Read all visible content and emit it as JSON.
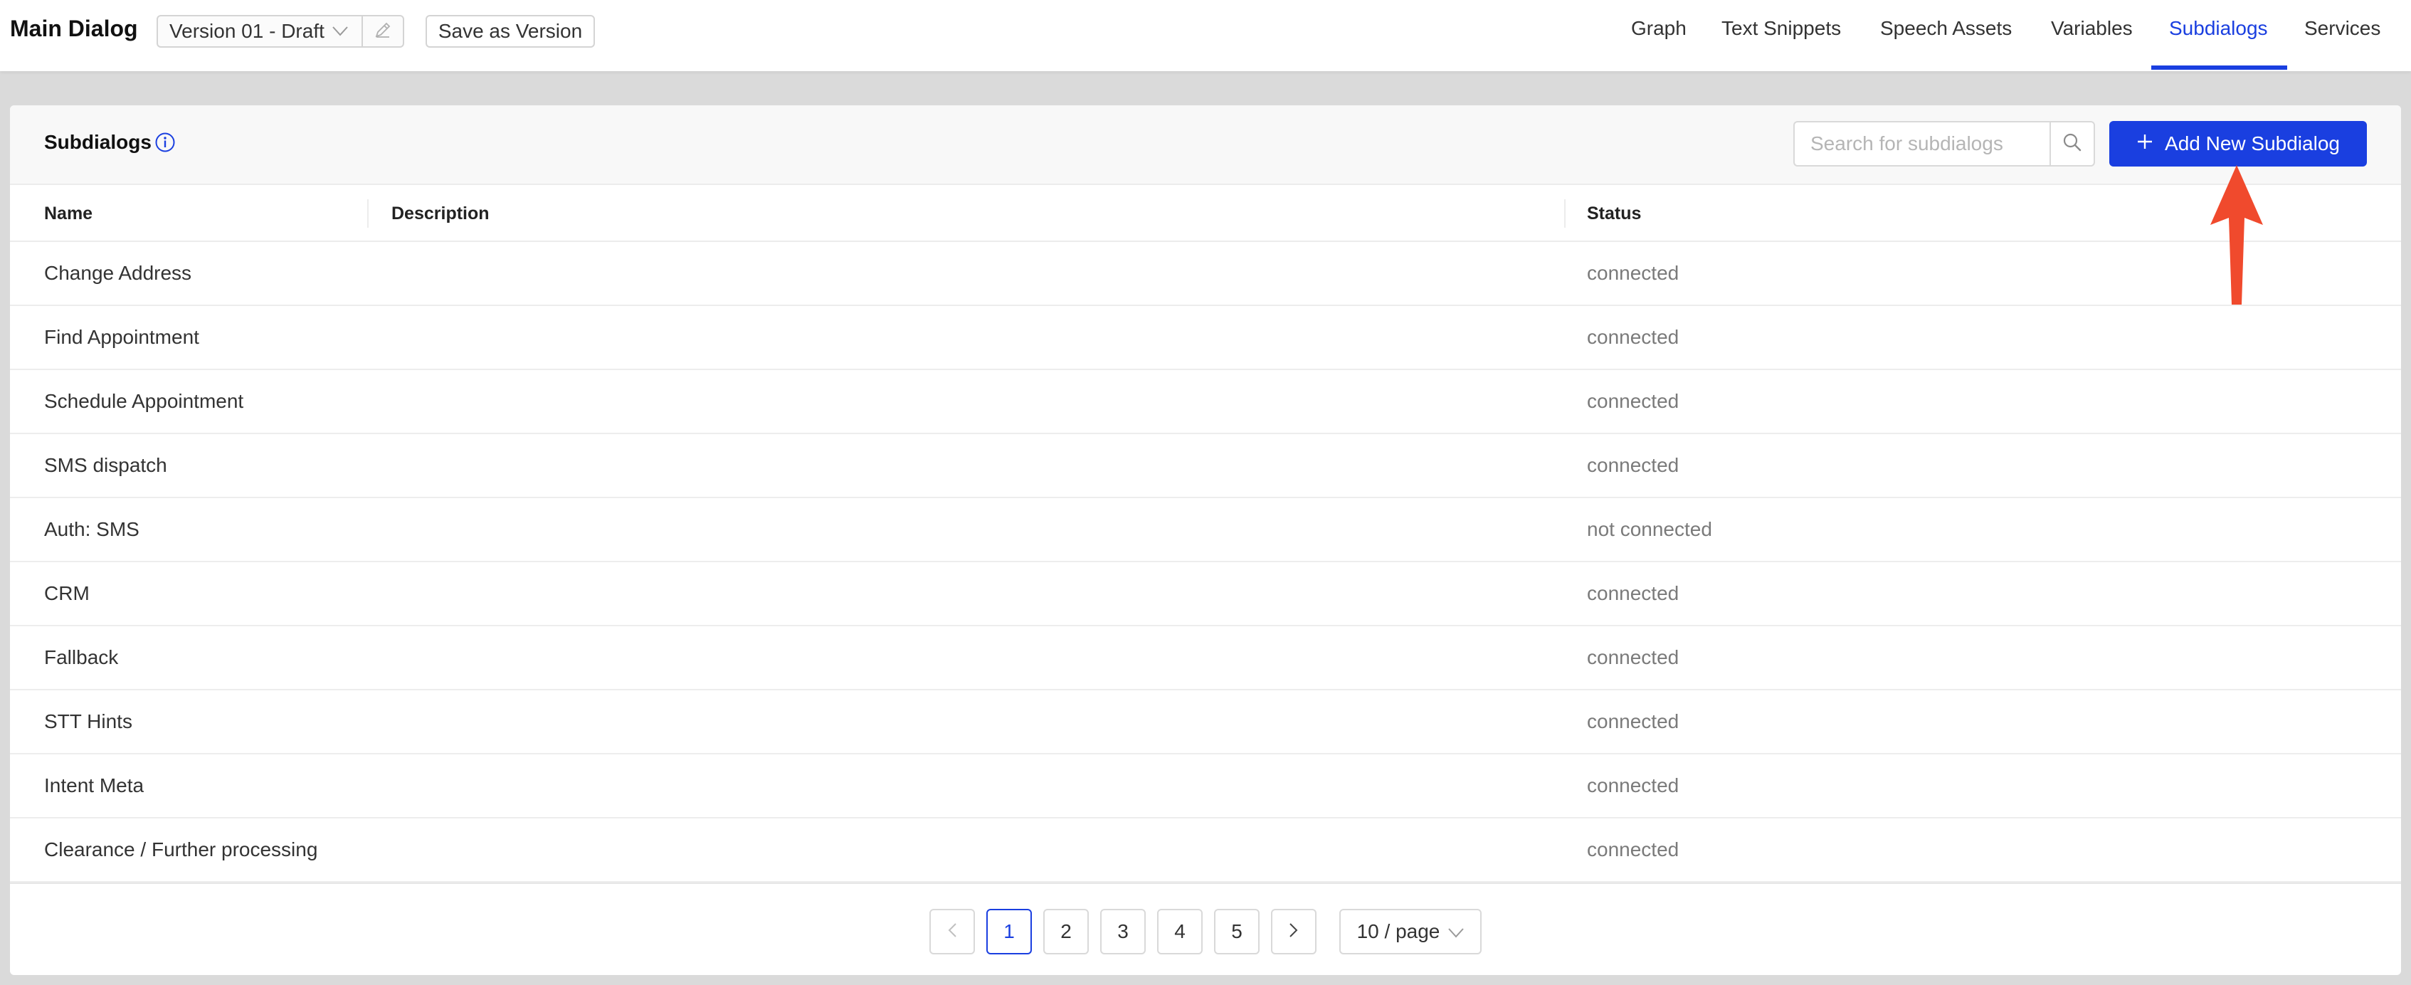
{
  "header": {
    "title": "Main Dialog",
    "version_label": "Version 01 - Draft",
    "save_label": "Save as Version",
    "tabs": [
      {
        "label": "Graph"
      },
      {
        "label": "Text Snippets"
      },
      {
        "label": "Speech Assets"
      },
      {
        "label": "Variables"
      },
      {
        "label": "Subdialogs"
      },
      {
        "label": "Services"
      }
    ],
    "active_tab": "Subdialogs"
  },
  "panel": {
    "title": "Subdialogs",
    "search_placeholder": "Search for subdialogs",
    "add_label": "Add New Subdialog"
  },
  "table": {
    "columns": [
      "Name",
      "Description",
      "Status"
    ],
    "rows": [
      {
        "name": "Change Address",
        "description": "",
        "status": "connected"
      },
      {
        "name": "Find Appointment",
        "description": "",
        "status": "connected"
      },
      {
        "name": "Schedule Appointment",
        "description": "",
        "status": "connected"
      },
      {
        "name": "SMS dispatch",
        "description": "",
        "status": "connected"
      },
      {
        "name": "Auth: SMS",
        "description": "",
        "status": "not connected"
      },
      {
        "name": "CRM",
        "description": "",
        "status": "connected"
      },
      {
        "name": "Fallback",
        "description": "",
        "status": "connected"
      },
      {
        "name": "STT Hints",
        "description": "",
        "status": "connected"
      },
      {
        "name": "Intent Meta",
        "description": "",
        "status": "connected"
      },
      {
        "name": "Clearance / Further processing",
        "description": "",
        "status": "connected"
      }
    ]
  },
  "pagination": {
    "pages": [
      "1",
      "2",
      "3",
      "4",
      "5"
    ],
    "current": "1",
    "page_size": "10 / page"
  },
  "colors": {
    "accent": "#1a3fe0",
    "annotation_arrow": "#f04a2d",
    "status_text": "#7a7a7a"
  },
  "icons": {
    "version_chevron": "chevron-down-icon",
    "version_edit": "pencil-icon",
    "info": "info-icon",
    "search": "search-icon",
    "add": "plus-icon",
    "prev": "chevron-left-icon",
    "next": "chevron-right-icon",
    "page_size_chevron": "chevron-down-icon",
    "annotation": "arrow-up-annotation"
  }
}
